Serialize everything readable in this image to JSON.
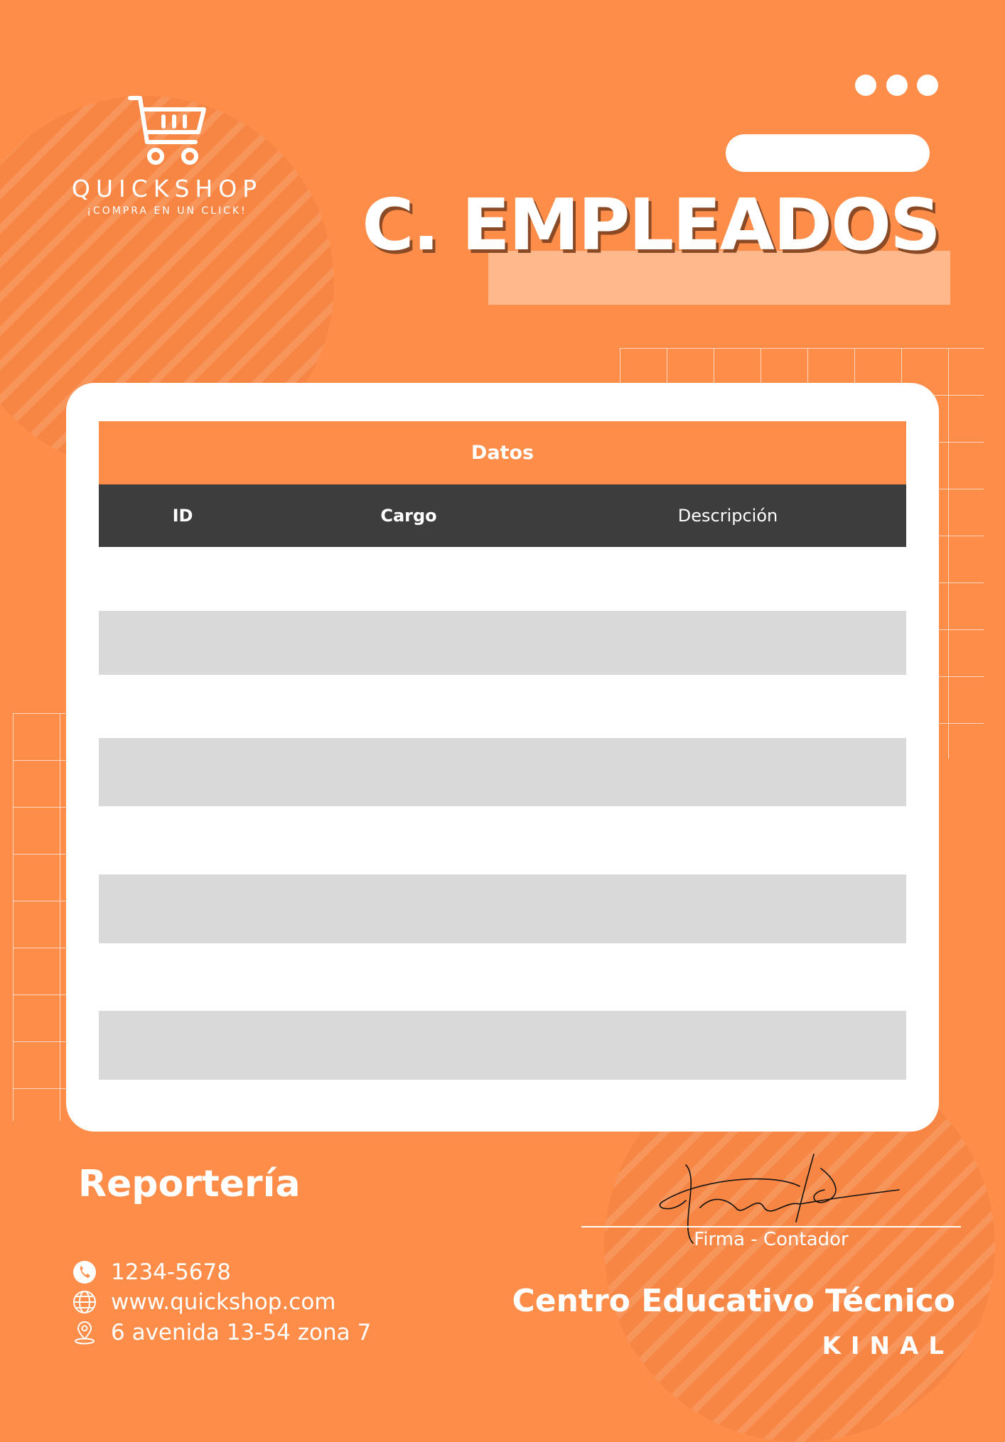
{
  "header": {
    "brand": "QUICKSHOP",
    "tagline": "¡COMPRA EN UN CLICK!",
    "title": "C. EMPLEADOS",
    "logo_icon": "shopping-cart-icon"
  },
  "table": {
    "caption": "Datos",
    "columns": [
      "ID",
      "Cargo",
      "Descripción"
    ],
    "rows": []
  },
  "footer": {
    "section_title": "Reportería",
    "phone": "1234-5678",
    "website": "www.quickshop.com",
    "address": "6 avenida 13-54 zona 7",
    "signature_label": "Firma - Contador",
    "school_name": "Centro Educativo Técnico",
    "school_subname": "KINAL"
  },
  "colors": {
    "background": "#FF8D4A",
    "table_header_dark": "#3D3D3D",
    "row_gray": "#D9D9D9"
  }
}
